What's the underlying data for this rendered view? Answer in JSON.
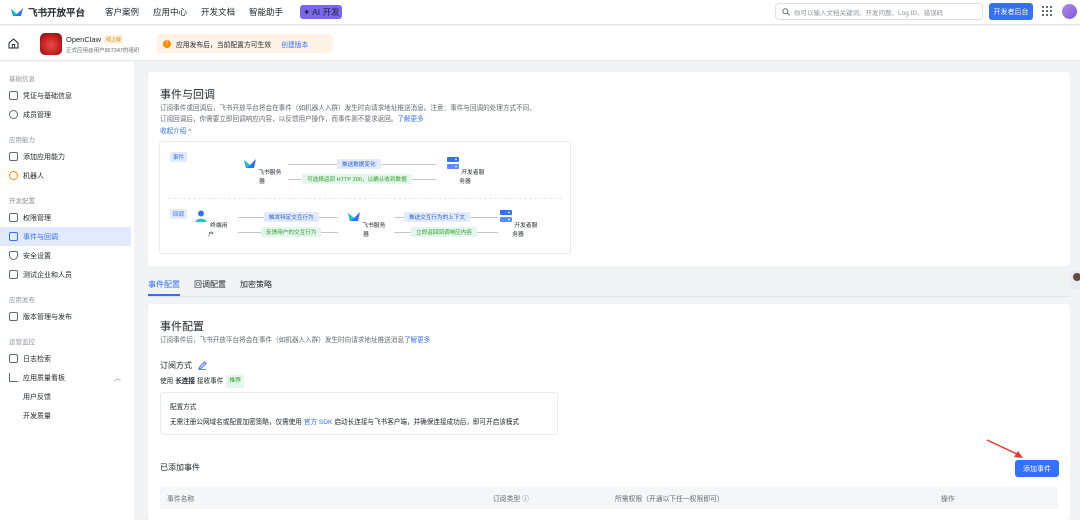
{
  "topbar": {
    "logo_text": "飞书开放平台",
    "nav": [
      "客户案例",
      "应用中心",
      "开发文档",
      "智能助手"
    ],
    "ai_badge": "✦ AI 开发",
    "search_placeholder": "你可以输入文档关键词、开发问题、Log ID、错误码",
    "dev_console_label": "开发者后台"
  },
  "app": {
    "name": "OpenClaw",
    "status_tag": "线上版",
    "subtitle": "正式应用@用户867347的组织",
    "notice_text": "应用发布后，当前配置方可生效",
    "notice_link": "创建版本"
  },
  "sidebar": {
    "groups": [
      {
        "title": "基础信息",
        "items": [
          {
            "label": "凭证与基础信息"
          },
          {
            "label": "成员管理"
          }
        ]
      },
      {
        "title": "应用能力",
        "items": [
          {
            "label": "添加应用能力"
          },
          {
            "label": "机器人"
          }
        ]
      },
      {
        "title": "开发配置",
        "items": [
          {
            "label": "权限管理"
          },
          {
            "label": "事件与回调"
          },
          {
            "label": "安全设置"
          },
          {
            "label": "测试企业和人员"
          }
        ]
      },
      {
        "title": "应用发布",
        "items": [
          {
            "label": "版本管理与发布"
          }
        ]
      },
      {
        "title": "运营监控",
        "items": [
          {
            "label": "日志检索"
          },
          {
            "label": "应用质量看板"
          },
          {
            "label": "用户反馈"
          },
          {
            "label": "开发质量"
          }
        ]
      }
    ]
  },
  "intro": {
    "title": "事件与回调",
    "desc_line1": "订阅事件或回调后，飞书开放平台将会在事件（如机器人入群）发生时向请求地址推送消息。注意：事件与回调的处理方式不同，",
    "desc_line2": "订阅回调后，你需要立即回调响应内容，以反馈用户操作，而事件则不要求返回。",
    "learn_more": "了解更多",
    "collapse": "收起介绍 ^",
    "diagram": {
      "event_label": "事件",
      "callback_label": "回调",
      "feishu_server": "飞书服务器",
      "dev_server": "开发者服务器",
      "end_user": "终端用户",
      "push_change": "推送数据变化",
      "ack_http": "可选择返回 HTTP 200，以确认收到数据",
      "trigger_action": "触发特定交互行为",
      "feedback_action": "反馈用户的交互行为",
      "push_context": "推送交互行为的上下文",
      "return_response": "立即返回回调响应内容"
    }
  },
  "tabs": [
    "事件配置",
    "回调配置",
    "加密策略"
  ],
  "event_config": {
    "title": "事件配置",
    "desc": "订阅事件后，飞书开放平台将会在事件（如机器人入群）发生时向请求地址推送消息",
    "learn_more": "了解更多",
    "sub_mode_title": "订阅方式",
    "mode_prefix": "使用",
    "mode_value": "长连接",
    "mode_suffix": "接收事件",
    "recommend_tag": "推荐",
    "config_title": "配置方式",
    "config_desc_prefix": "无需注册公网域名或配置加密策略，仅需使用",
    "config_desc_link": "官方 SDK",
    "config_desc_suffix": "启动长连接与飞书客户端，并确保连接成功后，即可开启该模式",
    "added_title": "已添加事件",
    "add_button": "添加事件",
    "columns": [
      "事件名称",
      "订阅类型 ⓘ",
      "所需权限（开通以下任一权限即可）",
      "操作"
    ]
  }
}
